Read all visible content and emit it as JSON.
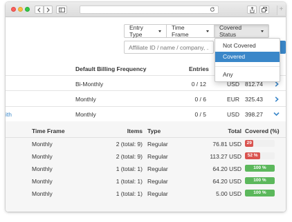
{
  "filters": {
    "entry_type": "Entry Type",
    "time_frame": "Time Frame",
    "covered_status": "Covered Status",
    "search_placeholder": "Affiliate ID / name / company, ...",
    "dropdown": [
      "Not Covered",
      "Covered",
      "Any"
    ]
  },
  "main_table": {
    "headers": {
      "billing": "Default Billing Frequency",
      "entries": "Entries"
    },
    "rows": [
      {
        "name": "",
        "billing": "Bi-Monthly",
        "entries": "0 / 12",
        "currency": "USD",
        "amount": "812.74",
        "expanded": false
      },
      {
        "name": "",
        "billing": "Monthly",
        "entries": "0 / 6",
        "currency": "EUR",
        "amount": "325.43",
        "expanded": false
      },
      {
        "name": "ith",
        "billing": "Monthly",
        "entries": "0 / 5",
        "currency": "USD",
        "amount": "398.27",
        "expanded": true
      }
    ]
  },
  "sub_table": {
    "headers": {
      "time_frame": "Time Frame",
      "items": "Items",
      "type": "Type",
      "total": "Total",
      "covered": "Covered (%)"
    },
    "rows": [
      {
        "time_frame": "Monthly",
        "items": "2 (total: 9)",
        "type": "Regular",
        "total": "76.81 USD",
        "covered_label": "29",
        "covered": 0.29,
        "status": "red"
      },
      {
        "time_frame": "Monthly",
        "items": "2 (total: 9)",
        "type": "Regular",
        "total": "113.27 USD",
        "covered_label": "52 %",
        "covered": 0.52,
        "status": "red"
      },
      {
        "time_frame": "Monthly",
        "items": "1 (total: 1)",
        "type": "Regular",
        "total": "64.20 USD",
        "covered_label": "100 %",
        "covered": 1.0,
        "status": "green"
      },
      {
        "time_frame": "Monthly",
        "items": "1 (total: 1)",
        "type": "Regular",
        "total": "64.20 USD",
        "covered_label": "100 %",
        "covered": 1.0,
        "status": "green"
      },
      {
        "time_frame": "Monthly",
        "items": "1 (total: 1)",
        "type": "Regular",
        "total": "5.00 USD",
        "covered_label": "100 %",
        "covered": 1.0,
        "status": "green"
      }
    ]
  },
  "colors": {
    "accent": "#3a87c9",
    "danger": "#d9534f",
    "success": "#5cb85c"
  }
}
